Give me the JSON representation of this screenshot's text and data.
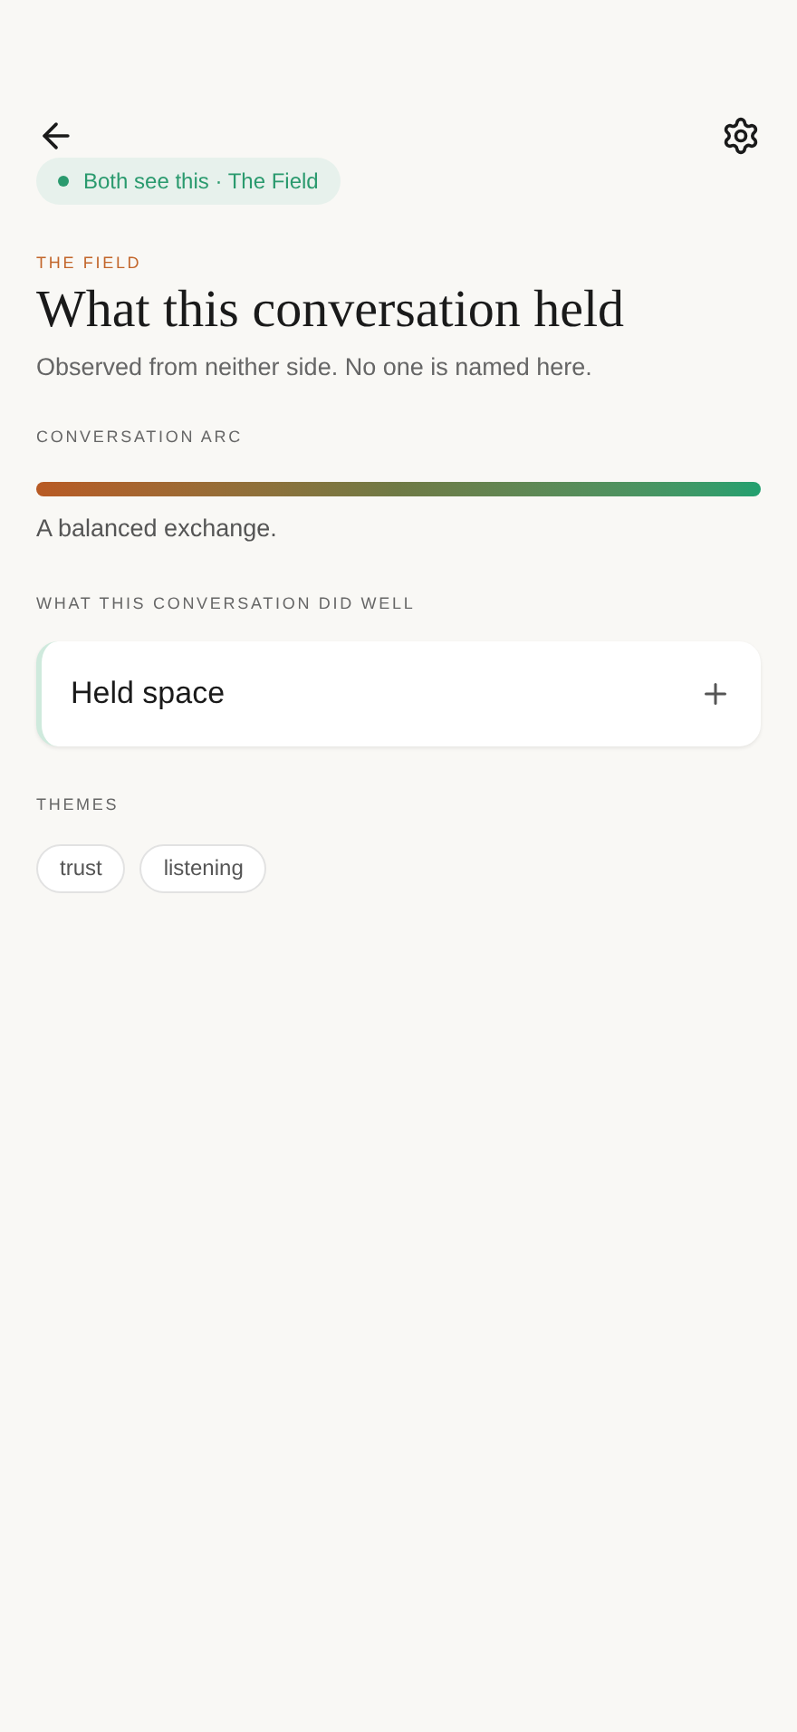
{
  "header": {
    "badge": "Both see this · The Field"
  },
  "eyebrow": "THE FIELD",
  "title": "What this conversation held",
  "subtitle": "Observed from neither side. No one is named here.",
  "arc": {
    "label": "CONVERSATION ARC",
    "caption": "A balanced exchange."
  },
  "strengths": {
    "label": "WHAT THIS CONVERSATION DID WELL",
    "items": [
      {
        "title": "Held space",
        "expanded": false
      }
    ]
  },
  "themes": {
    "label": "THEMES",
    "tags": [
      "trust",
      "listening"
    ]
  }
}
